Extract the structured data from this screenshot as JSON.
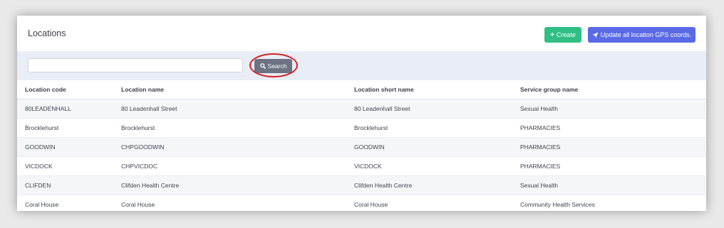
{
  "header": {
    "title": "Locations",
    "create_label": "Create",
    "update_label": "Update all location GPS coords."
  },
  "search": {
    "value": "",
    "button_label": "Search"
  },
  "table": {
    "columns": [
      "Location code",
      "Location name",
      "Location short name",
      "Service group name"
    ],
    "rows": [
      [
        "80LEADENHALL",
        "80 Leadenhall Street",
        "80 Leadenhall Street",
        "Sexual Health"
      ],
      [
        "Brocklehurst",
        "Brocklehurst",
        "Brocklehurst",
        "PHARMACIES"
      ],
      [
        "GOODWIN",
        "CHPGOODWIN",
        "GOODWIN",
        "PHARMACIES"
      ],
      [
        "VICDOCK",
        "CHPVICDOC",
        "VICDOCK",
        "PHARMACIES"
      ],
      [
        "CLIFDEN",
        "Clifden Health Centre",
        "Clifden Health Centre",
        "Sexual Health"
      ],
      [
        "Coral House",
        "Coral House",
        "Coral House",
        "Community Health Services"
      ]
    ]
  },
  "icons": {
    "create": "plus-icon",
    "update": "location-arrow-icon",
    "search": "search-icon"
  },
  "colors": {
    "create": "#2fbf85",
    "update": "#5a69e6",
    "search_button": "#6d7383",
    "highlight": "#d42020"
  }
}
